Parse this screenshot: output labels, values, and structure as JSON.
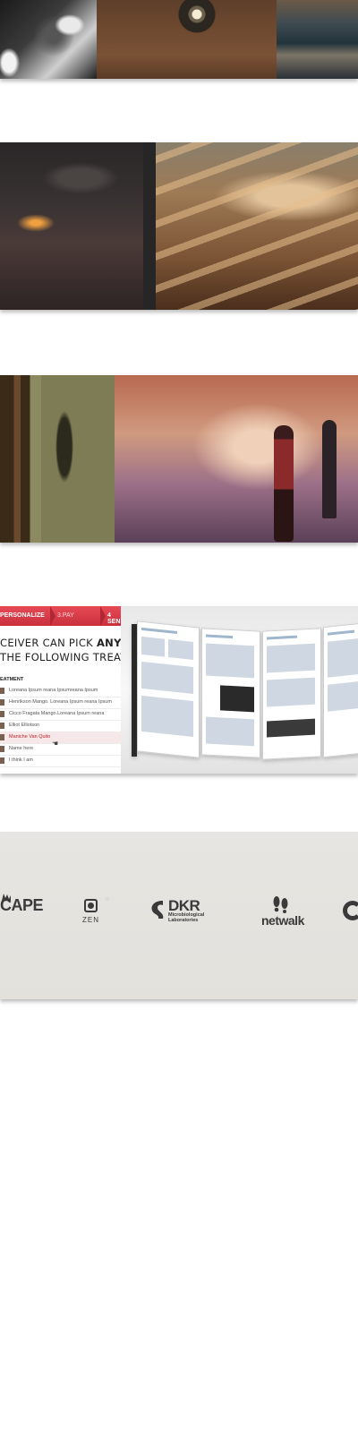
{
  "tabs": {
    "step1": "PERSONALIZE",
    "step2": "3.PAY",
    "step3": "4 SEN"
  },
  "headline": {
    "line1_pre": "CEIVER CAN PICK ",
    "line1_bold": "ANY",
    "line2": "THE FOLLOWING TREATME"
  },
  "treatments": {
    "label": "EATMENT",
    "rows": [
      "Loreana Ipsum reana Ipsumreana Ipsum",
      "Henrikson Mango. Loreana Ipsum reana Ipsum",
      "Cicco Fragata Mango.Loreana Ipsum reana",
      "Elliot Elliotson",
      "Maniche Van Quito",
      "Name here",
      "I think I am"
    ]
  },
  "logos": {
    "cape": "CAPE",
    "zen": "ZEN",
    "dkr": "DKR",
    "dkr_sub1": "Microbiological",
    "dkr_sub2": "Laboratories",
    "netwalk": "netwalk"
  },
  "colors": {
    "accent_red": "#d93a46",
    "text_dark": "#222222",
    "logo_gray": "#3a3a3a"
  },
  "icons": {
    "cursor": "hand-pointer-icon"
  }
}
